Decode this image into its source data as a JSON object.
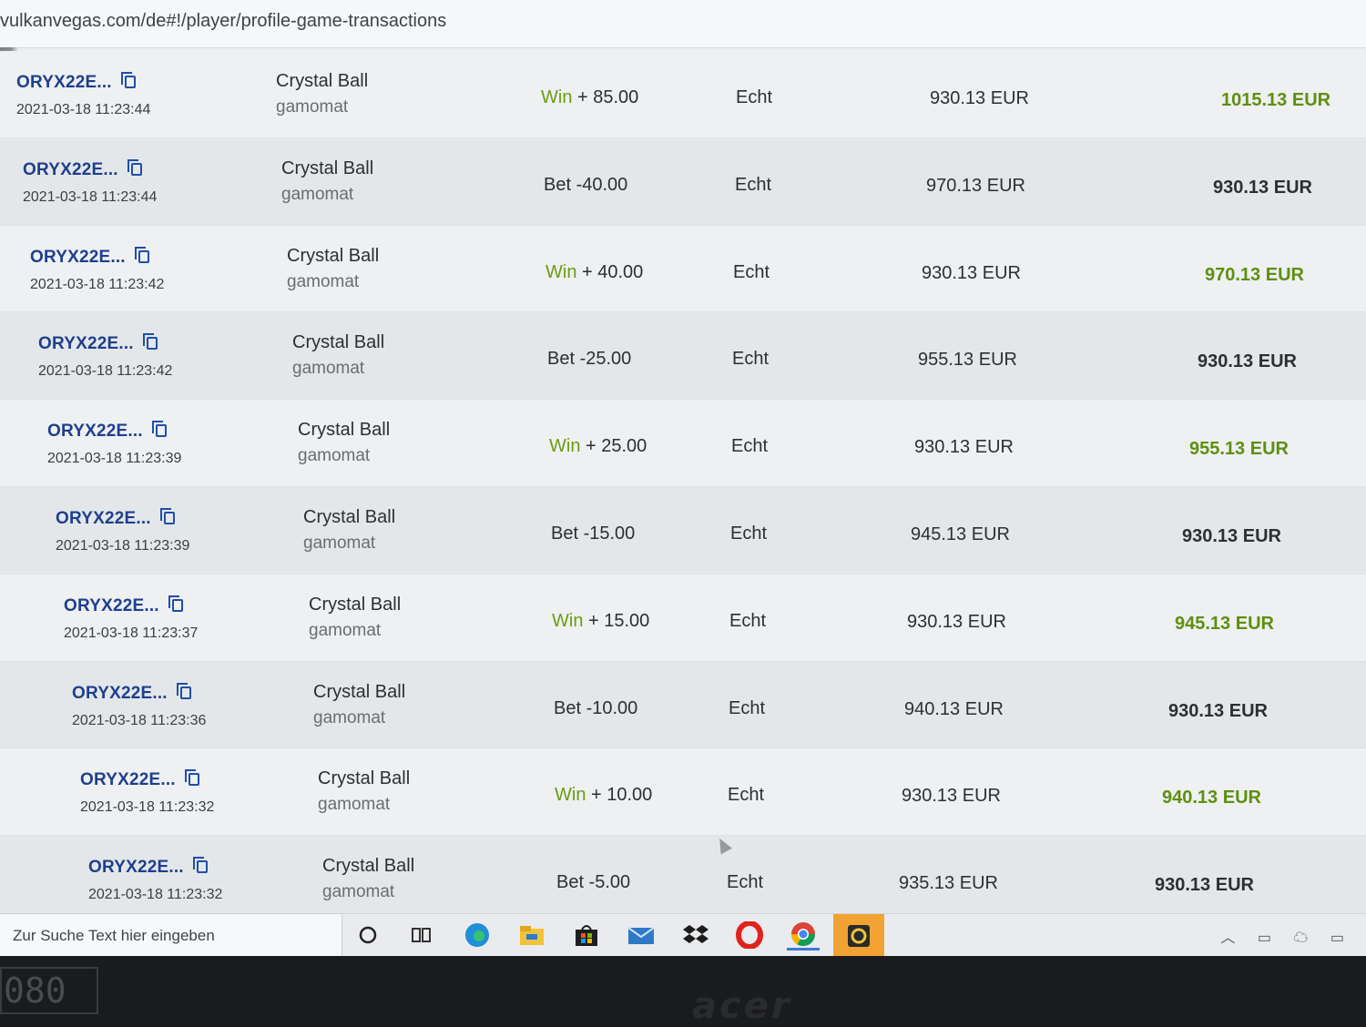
{
  "browser": {
    "url": "vulkanvegas.com/de#!/player/profile-game-transactions"
  },
  "colors": {
    "win_green": "#6b9c12",
    "link_blue": "#1f3f8c"
  },
  "transactions": [
    {
      "id": "ORYX22E...",
      "timestamp": "2021-03-18 11:23:44",
      "game": "Crystal Ball",
      "provider": "gamomat",
      "kind": "Win",
      "amount": "+ 85.00",
      "mode": "Echt",
      "balance_before": "930.13 EUR",
      "balance_after": "1015.13 EUR"
    },
    {
      "id": "ORYX22E...",
      "timestamp": "2021-03-18 11:23:44",
      "game": "Crystal Ball",
      "provider": "gamomat",
      "kind": "Bet",
      "amount": "-40.00",
      "mode": "Echt",
      "balance_before": "970.13 EUR",
      "balance_after": "930.13 EUR"
    },
    {
      "id": "ORYX22E...",
      "timestamp": "2021-03-18 11:23:42",
      "game": "Crystal Ball",
      "provider": "gamomat",
      "kind": "Win",
      "amount": "+ 40.00",
      "mode": "Echt",
      "balance_before": "930.13 EUR",
      "balance_after": "970.13 EUR"
    },
    {
      "id": "ORYX22E...",
      "timestamp": "2021-03-18 11:23:42",
      "game": "Crystal Ball",
      "provider": "gamomat",
      "kind": "Bet",
      "amount": "-25.00",
      "mode": "Echt",
      "balance_before": "955.13 EUR",
      "balance_after": "930.13 EUR"
    },
    {
      "id": "ORYX22E...",
      "timestamp": "2021-03-18 11:23:39",
      "game": "Crystal Ball",
      "provider": "gamomat",
      "kind": "Win",
      "amount": "+ 25.00",
      "mode": "Echt",
      "balance_before": "930.13 EUR",
      "balance_after": "955.13 EUR"
    },
    {
      "id": "ORYX22E...",
      "timestamp": "2021-03-18 11:23:39",
      "game": "Crystal Ball",
      "provider": "gamomat",
      "kind": "Bet",
      "amount": "-15.00",
      "mode": "Echt",
      "balance_before": "945.13 EUR",
      "balance_after": "930.13 EUR"
    },
    {
      "id": "ORYX22E...",
      "timestamp": "2021-03-18 11:23:37",
      "game": "Crystal Ball",
      "provider": "gamomat",
      "kind": "Win",
      "amount": "+ 15.00",
      "mode": "Echt",
      "balance_before": "930.13 EUR",
      "balance_after": "945.13 EUR"
    },
    {
      "id": "ORYX22E...",
      "timestamp": "2021-03-18 11:23:36",
      "game": "Crystal Ball",
      "provider": "gamomat",
      "kind": "Bet",
      "amount": "-10.00",
      "mode": "Echt",
      "balance_before": "940.13 EUR",
      "balance_after": "930.13 EUR"
    },
    {
      "id": "ORYX22E...",
      "timestamp": "2021-03-18 11:23:32",
      "game": "Crystal Ball",
      "provider": "gamomat",
      "kind": "Win",
      "amount": "+ 10.00",
      "mode": "Echt",
      "balance_before": "930.13 EUR",
      "balance_after": "940.13 EUR"
    },
    {
      "id": "ORYX22E...",
      "timestamp": "2021-03-18 11:23:32",
      "game": "Crystal Ball",
      "provider": "gamomat",
      "kind": "Bet",
      "amount": "-5.00",
      "mode": "Echt",
      "balance_before": "935.13 EUR",
      "balance_after": "930.13 EUR"
    }
  ],
  "taskbar": {
    "search_placeholder": "Zur Suche Text hier eingeben",
    "icons": [
      "cortana-icon",
      "task-view-icon",
      "edge-icon",
      "file-explorer-icon",
      "store-icon",
      "mail-icon",
      "dropbox-icon",
      "opera-icon",
      "chrome-icon",
      "app-icon"
    ]
  },
  "bezel": {
    "counter": "080",
    "brand": "acer"
  }
}
